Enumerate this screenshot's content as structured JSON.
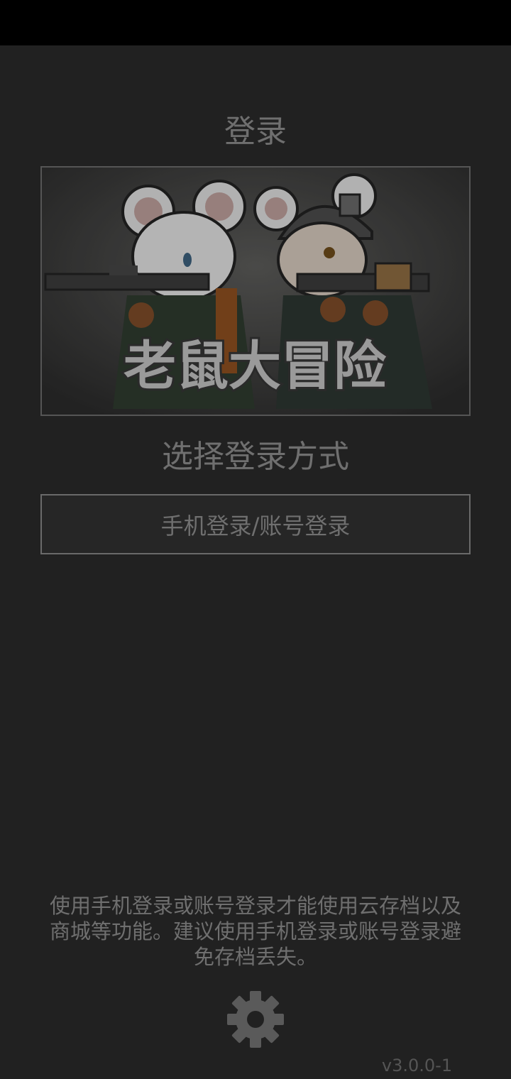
{
  "header": {
    "title": "登录"
  },
  "banner": {
    "game_title": "老鼠大冒险"
  },
  "login": {
    "prompt": "选择登录方式",
    "phone_account_button": "手机登录/账号登录"
  },
  "footer": {
    "notice": "使用手机登录或账号登录才能使用云存档以及商城等功能。建议使用手机登录或账号登录避免存档丢失。",
    "version": "v3.0.0-1",
    "settings_icon": "gear-icon"
  },
  "colors": {
    "background": "#212121",
    "status_bar": "#000000",
    "text": "#6f6f6f",
    "border": "#6a6a6a"
  }
}
